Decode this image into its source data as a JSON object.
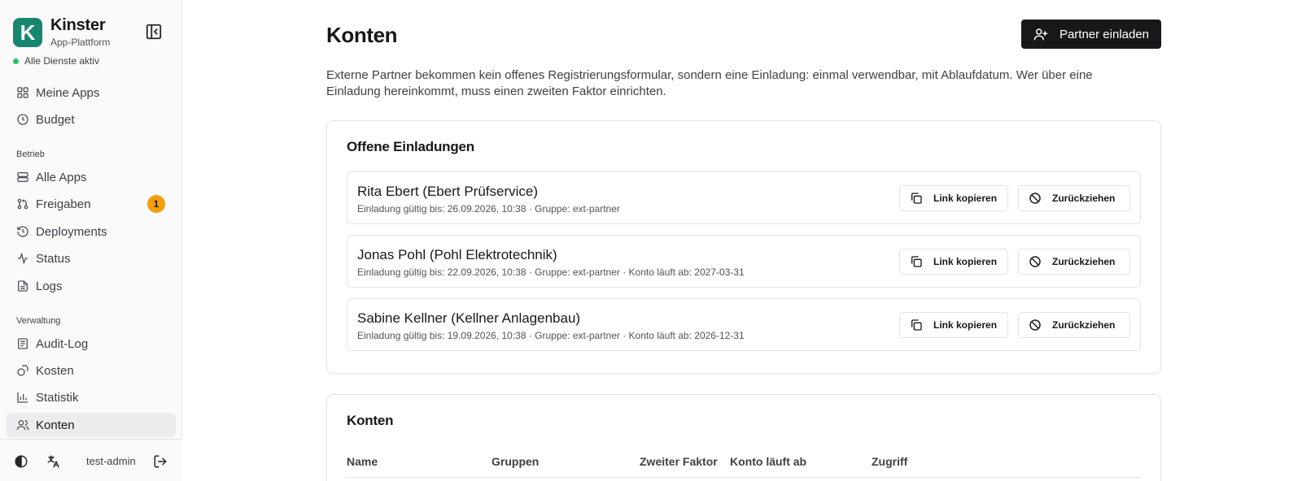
{
  "sidebar": {
    "app_name": "Kinster",
    "app_subtitle": "App-Plattform",
    "logo_letter": "K",
    "status_text": "Alle Dienste aktiv",
    "top_items": [
      {
        "label": "Meine Apps",
        "icon": "grid-icon"
      },
      {
        "label": "Budget",
        "icon": "clock-icon"
      }
    ],
    "section_betrieb": "Betrieb",
    "betrieb_items": [
      {
        "label": "Alle Apps",
        "icon": "server-icon"
      },
      {
        "label": "Freigaben",
        "icon": "pull-request-icon",
        "badge": "1"
      },
      {
        "label": "Deployments",
        "icon": "history-icon"
      },
      {
        "label": "Status",
        "icon": "activity-icon"
      },
      {
        "label": "Logs",
        "icon": "file-text-icon"
      }
    ],
    "section_verwaltung": "Verwaltung",
    "verwaltung_items": [
      {
        "label": "Audit-Log",
        "icon": "audit-log-icon"
      },
      {
        "label": "Kosten",
        "icon": "coins-icon"
      },
      {
        "label": "Statistik",
        "icon": "bar-chart-icon"
      },
      {
        "label": "Konten",
        "icon": "users-icon",
        "active": true
      }
    ],
    "footer": {
      "user": "test-admin"
    }
  },
  "main": {
    "title": "Konten",
    "invite_button": "Partner einladen",
    "intro": "Externe Partner bekommen kein offenes Registrierungsformular, sondern eine Einladung: einmal verwendbar, mit Ablaufdatum. Wer über eine Einladung hereinkommt, muss einen zweiten Faktor einrichten.",
    "open_invites": {
      "title": "Offene Einladungen",
      "copy_label": "Link kopieren",
      "revoke_label": "Zurückziehen",
      "items": [
        {
          "name": "Rita Ebert (Ebert Prüfservice)",
          "meta": "Einladung gültig bis: 26.09.2026, 10:38 · Gruppe: ext-partner"
        },
        {
          "name": "Jonas Pohl (Pohl Elektrotechnik)",
          "meta": "Einladung gültig bis: 22.09.2026, 10:38 · Gruppe: ext-partner · Konto läuft ab: 2027-03-31"
        },
        {
          "name": "Sabine Kellner (Kellner Anlagenbau)",
          "meta": "Einladung gültig bis: 19.09.2026, 10:38 · Gruppe: ext-partner · Konto läuft ab: 2026-12-31"
        }
      ]
    },
    "accounts": {
      "title": "Konten",
      "columns": [
        "Name",
        "Gruppen",
        "Zweiter Faktor",
        "Konto läuft ab",
        "Zugriff"
      ]
    }
  }
}
